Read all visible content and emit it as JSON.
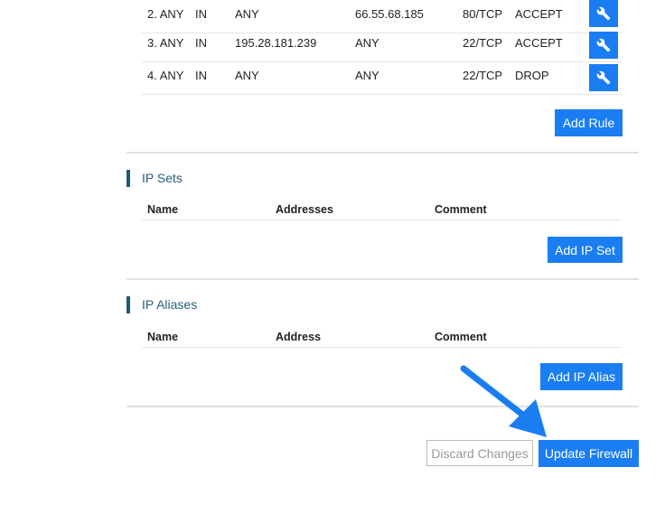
{
  "rules": [
    {
      "num": "2. ANY",
      "dir": "IN",
      "source": "ANY",
      "dest": "66.55.68.185",
      "port": "80/TCP",
      "action": "ACCEPT"
    },
    {
      "num": "3. ANY",
      "dir": "IN",
      "source": "195.28.181.239",
      "dest": "ANY",
      "port": "22/TCP",
      "action": "ACCEPT"
    },
    {
      "num": "4. ANY",
      "dir": "IN",
      "source": "ANY",
      "dest": "ANY",
      "port": "22/TCP",
      "action": "DROP"
    }
  ],
  "add_rule_label": "Add Rule",
  "ip_sets": {
    "title": "IP Sets",
    "columns": [
      "Name",
      "Addresses",
      "Comment"
    ],
    "add_label": "Add IP Set"
  },
  "ip_aliases": {
    "title": "IP Aliases",
    "columns": [
      "Name",
      "Address",
      "Comment"
    ],
    "add_label": "Add IP Alias"
  },
  "footer": {
    "discard_label": "Discard Changes",
    "update_label": "Update Firewall"
  },
  "colors": {
    "accent": "#1a7ef2",
    "section_title": "#2a5d7c",
    "arrow": "#1a7ef2"
  }
}
